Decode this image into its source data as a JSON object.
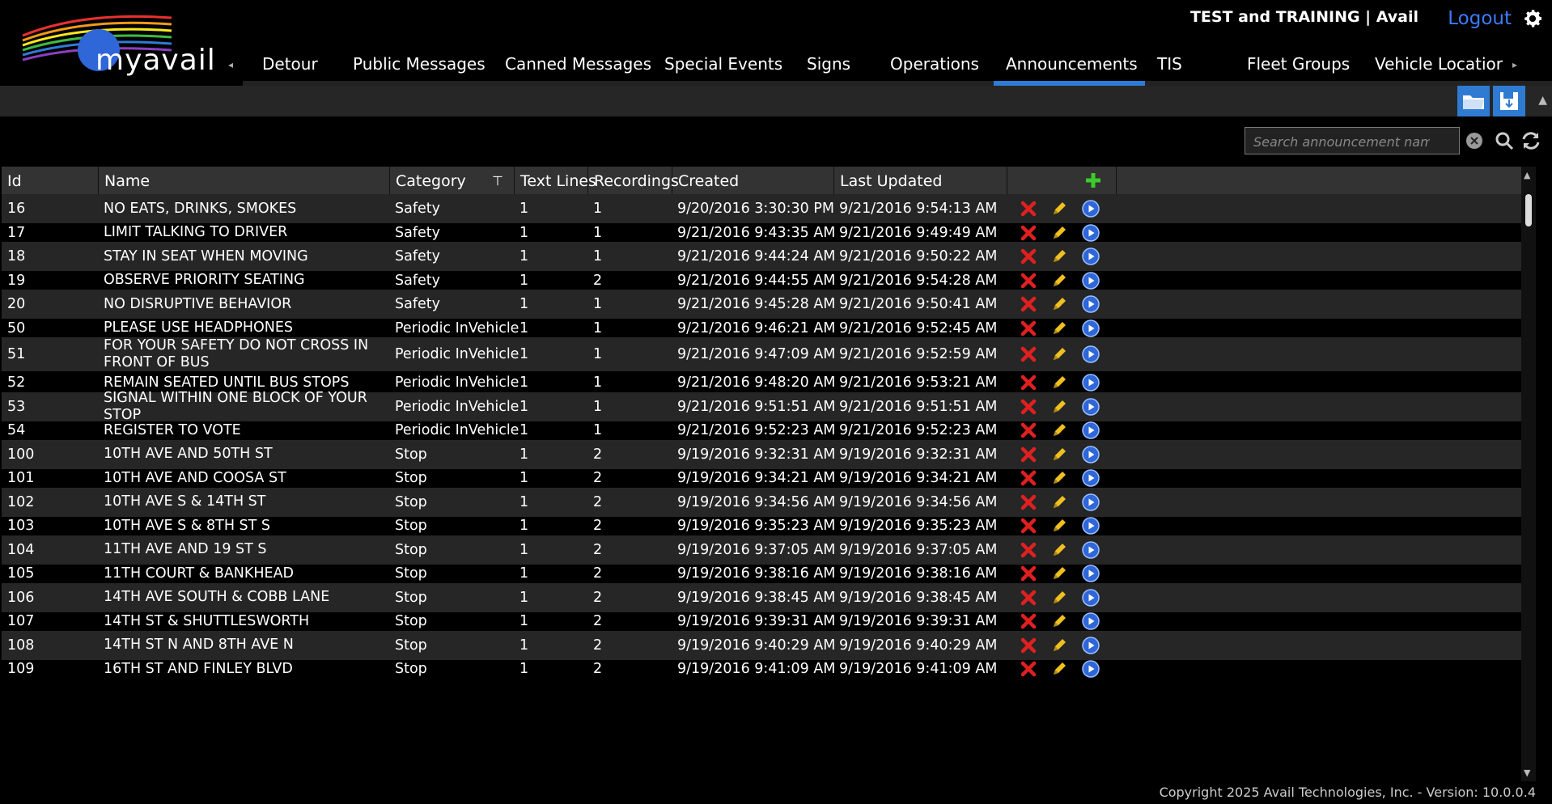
{
  "header": {
    "env_label": "TEST and TRAINING | Avail",
    "logout_label": "Logout",
    "logo_text": "myavail"
  },
  "nav": {
    "tabs": [
      {
        "label": "Detour"
      },
      {
        "label": "Public Messages"
      },
      {
        "label": "Canned Messages"
      },
      {
        "label": "Special Events"
      },
      {
        "label": "Signs"
      },
      {
        "label": "Operations"
      },
      {
        "label": "Announcements",
        "active": true
      },
      {
        "label": "TIS"
      },
      {
        "label": "Fleet Groups"
      },
      {
        "label": "Vehicle Locatior"
      }
    ],
    "left_arrow": "◂",
    "right_arrow": "▸"
  },
  "search": {
    "placeholder": "Search announcement names"
  },
  "table": {
    "columns": [
      "Id",
      "Name",
      "Category",
      "Text Lines",
      "Recordings",
      "Created",
      "Last Updated"
    ],
    "rows": [
      {
        "id": "16",
        "name": "NO EATS, DRINKS, SMOKES",
        "category": "Safety",
        "text_lines": "1",
        "recordings": "1",
        "created": "9/20/2016 3:30:30 PM",
        "last_updated": "9/21/2016 9:54:13 AM"
      },
      {
        "id": "17",
        "name": "LIMIT TALKING TO DRIVER",
        "category": "Safety",
        "text_lines": "1",
        "recordings": "1",
        "created": "9/21/2016 9:43:35 AM",
        "last_updated": "9/21/2016 9:49:49 AM"
      },
      {
        "id": "18",
        "name": "STAY IN SEAT WHEN MOVING",
        "category": "Safety",
        "text_lines": "1",
        "recordings": "1",
        "created": "9/21/2016 9:44:24 AM",
        "last_updated": "9/21/2016 9:50:22 AM"
      },
      {
        "id": "19",
        "name": "OBSERVE PRIORITY SEATING",
        "category": "Safety",
        "text_lines": "1",
        "recordings": "2",
        "created": "9/21/2016 9:44:55 AM",
        "last_updated": "9/21/2016 9:54:28 AM"
      },
      {
        "id": "20",
        "name": "NO DISRUPTIVE BEHAVIOR",
        "category": "Safety",
        "text_lines": "1",
        "recordings": "1",
        "created": "9/21/2016 9:45:28 AM",
        "last_updated": "9/21/2016 9:50:41 AM"
      },
      {
        "id": "50",
        "name": "PLEASE USE HEADPHONES",
        "category": "Periodic InVehicle",
        "text_lines": "1",
        "recordings": "1",
        "created": "9/21/2016 9:46:21 AM",
        "last_updated": "9/21/2016 9:52:45 AM"
      },
      {
        "id": "51",
        "name": "FOR YOUR SAFETY DO NOT CROSS IN FRONT OF BUS",
        "category": "Periodic InVehicle",
        "text_lines": "1",
        "recordings": "1",
        "created": "9/21/2016 9:47:09 AM",
        "last_updated": "9/21/2016 9:52:59 AM"
      },
      {
        "id": "52",
        "name": "REMAIN SEATED UNTIL BUS STOPS",
        "category": "Periodic InVehicle",
        "text_lines": "1",
        "recordings": "1",
        "created": "9/21/2016 9:48:20 AM",
        "last_updated": "9/21/2016 9:53:21 AM"
      },
      {
        "id": "53",
        "name": "SIGNAL WITHIN ONE BLOCK OF YOUR STOP",
        "category": "Periodic InVehicle",
        "text_lines": "1",
        "recordings": "1",
        "created": "9/21/2016 9:51:51 AM",
        "last_updated": "9/21/2016 9:51:51 AM"
      },
      {
        "id": "54",
        "name": "REGISTER TO VOTE",
        "category": "Periodic InVehicle",
        "text_lines": "1",
        "recordings": "1",
        "created": "9/21/2016 9:52:23 AM",
        "last_updated": "9/21/2016 9:52:23 AM"
      },
      {
        "id": "100",
        "name": "10TH AVE AND 50TH ST",
        "category": "Stop",
        "text_lines": "1",
        "recordings": "2",
        "created": "9/19/2016 9:32:31 AM",
        "last_updated": "9/19/2016 9:32:31 AM"
      },
      {
        "id": "101",
        "name": "10TH AVE AND COOSA ST",
        "category": "Stop",
        "text_lines": "1",
        "recordings": "2",
        "created": "9/19/2016 9:34:21 AM",
        "last_updated": "9/19/2016 9:34:21 AM"
      },
      {
        "id": "102",
        "name": "10TH AVE S & 14TH ST",
        "category": "Stop",
        "text_lines": "1",
        "recordings": "2",
        "created": "9/19/2016 9:34:56 AM",
        "last_updated": "9/19/2016 9:34:56 AM"
      },
      {
        "id": "103",
        "name": "10TH AVE S & 8TH ST S",
        "category": "Stop",
        "text_lines": "1",
        "recordings": "2",
        "created": "9/19/2016 9:35:23 AM",
        "last_updated": "9/19/2016 9:35:23 AM"
      },
      {
        "id": "104",
        "name": "11TH AVE AND 19 ST S",
        "category": "Stop",
        "text_lines": "1",
        "recordings": "2",
        "created": "9/19/2016 9:37:05 AM",
        "last_updated": "9/19/2016 9:37:05 AM"
      },
      {
        "id": "105",
        "name": "11TH COURT & BANKHEAD",
        "category": "Stop",
        "text_lines": "1",
        "recordings": "2",
        "created": "9/19/2016 9:38:16 AM",
        "last_updated": "9/19/2016 9:38:16 AM"
      },
      {
        "id": "106",
        "name": "14TH AVE SOUTH & COBB LANE",
        "category": "Stop",
        "text_lines": "1",
        "recordings": "2",
        "created": "9/19/2016 9:38:45 AM",
        "last_updated": "9/19/2016 9:38:45 AM"
      },
      {
        "id": "107",
        "name": "14TH ST & SHUTTLESWORTH",
        "category": "Stop",
        "text_lines": "1",
        "recordings": "2",
        "created": "9/19/2016 9:39:31 AM",
        "last_updated": "9/19/2016 9:39:31 AM"
      },
      {
        "id": "108",
        "name": "14TH ST N AND 8TH AVE N",
        "category": "Stop",
        "text_lines": "1",
        "recordings": "2",
        "created": "9/19/2016 9:40:29 AM",
        "last_updated": "9/19/2016 9:40:29 AM"
      },
      {
        "id": "109",
        "name": "16TH ST AND FINLEY BLVD",
        "category": "Stop",
        "text_lines": "1",
        "recordings": "2",
        "created": "9/19/2016 9:41:09 AM",
        "last_updated": "9/19/2016 9:41:09 AM"
      }
    ]
  },
  "footer": {
    "copyright": "Copyright 2025 Avail Technologies, Inc. - Version: 10.0.0.4"
  },
  "colors": {
    "accent": "#2e7bd6",
    "logout": "#3d7bff",
    "delete": "#e02020",
    "edit": "#f0c020",
    "add": "#3ccb2a"
  },
  "icons": {
    "open_folder": "folder-icon",
    "save": "save-icon",
    "delete": "delete-icon",
    "edit": "edit-icon",
    "play": "play-icon",
    "add": "add-icon",
    "search": "search-icon",
    "refresh": "refresh-icon",
    "settings": "gear-icon",
    "filter": "filter-icon"
  }
}
